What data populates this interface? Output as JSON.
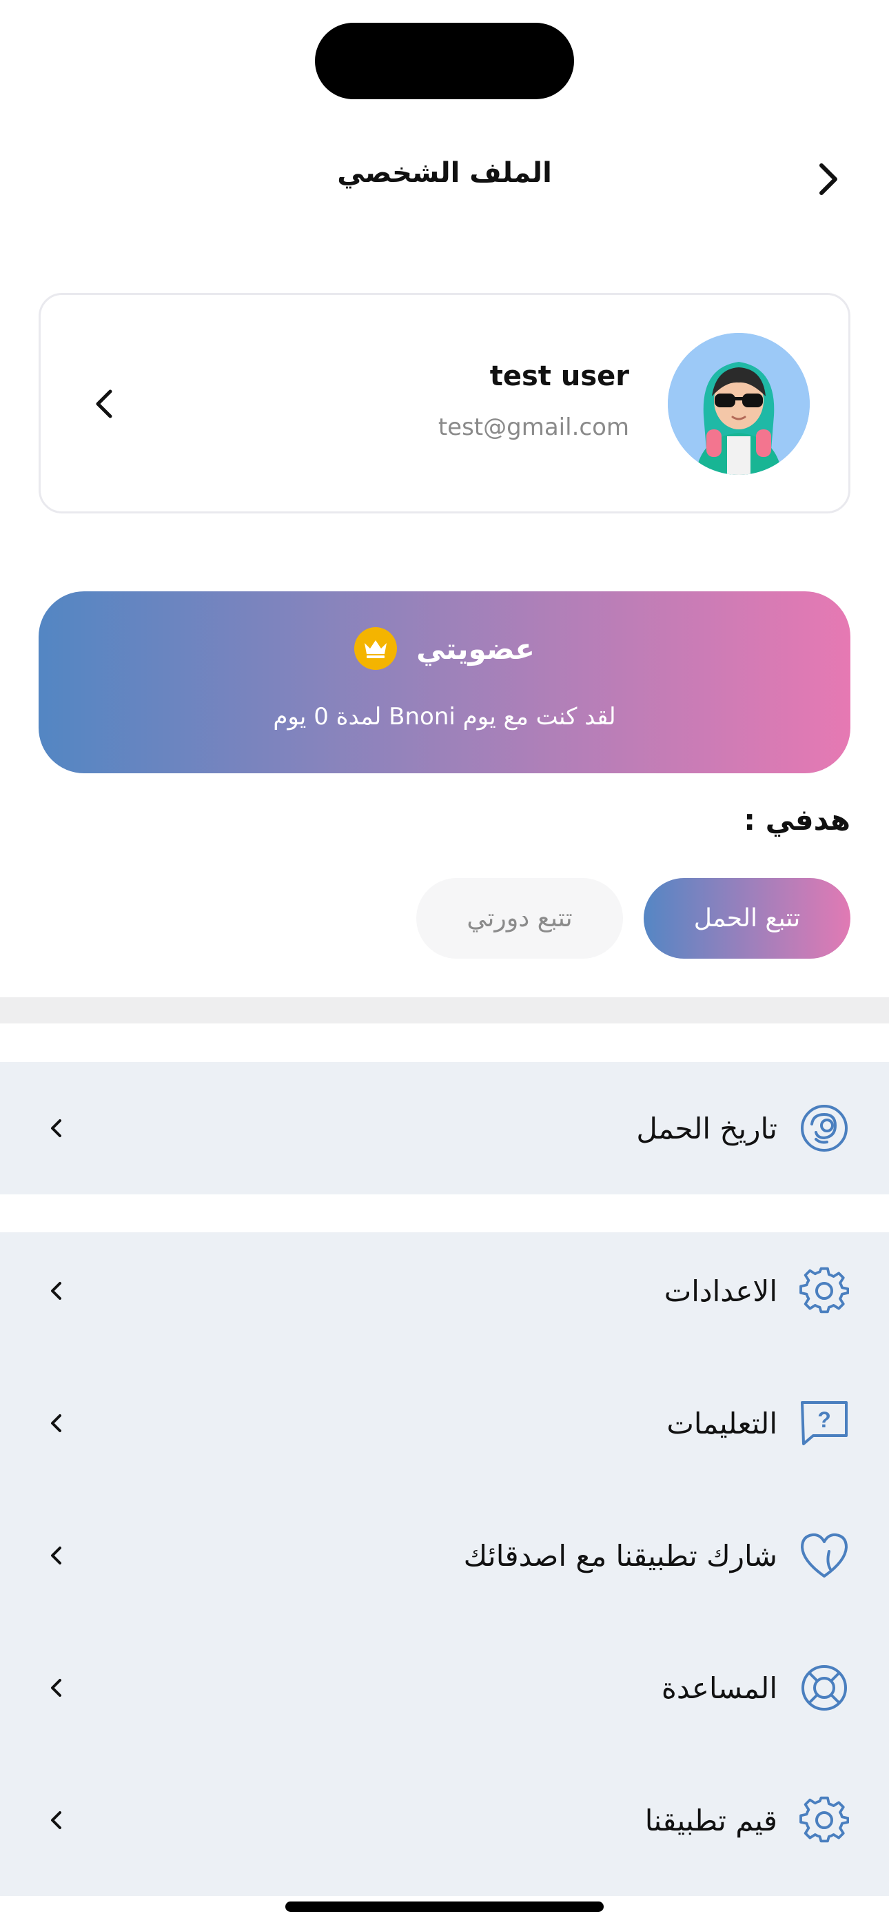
{
  "header": {
    "title": "الملف الشخصي"
  },
  "profile": {
    "name": "test user",
    "email": "test@gmail.com"
  },
  "membership": {
    "title": "عضويتي",
    "subtitle": "لقد كنت مع يوم Bnoni لمدة 0 يوم"
  },
  "goal": {
    "label": "هدفي :",
    "options": [
      "تتبع الحمل",
      "تتبع دورتي"
    ],
    "selected": "تتبع الحمل"
  },
  "menu": {
    "section1": [
      {
        "label": "تاريخ الحمل",
        "icon": "baby-icon"
      }
    ],
    "section2": [
      {
        "label": "الاعدادات",
        "icon": "gear-icon"
      },
      {
        "label": "التعليمات",
        "icon": "question-bubble-icon"
      },
      {
        "label": "شارك تطبيقنا مع اصدقائك",
        "icon": "heart-icon"
      },
      {
        "label": "المساعدة",
        "icon": "lifebuoy-icon"
      },
      {
        "label": "قيم تطبيقنا",
        "icon": "gear-icon"
      }
    ]
  },
  "colors": {
    "accent_blue": "#4a7fbf",
    "gradient_start": "#5386c3",
    "gradient_end": "#e679b3",
    "crown": "#f4b400",
    "menu_bg": "#ecf0f5"
  }
}
